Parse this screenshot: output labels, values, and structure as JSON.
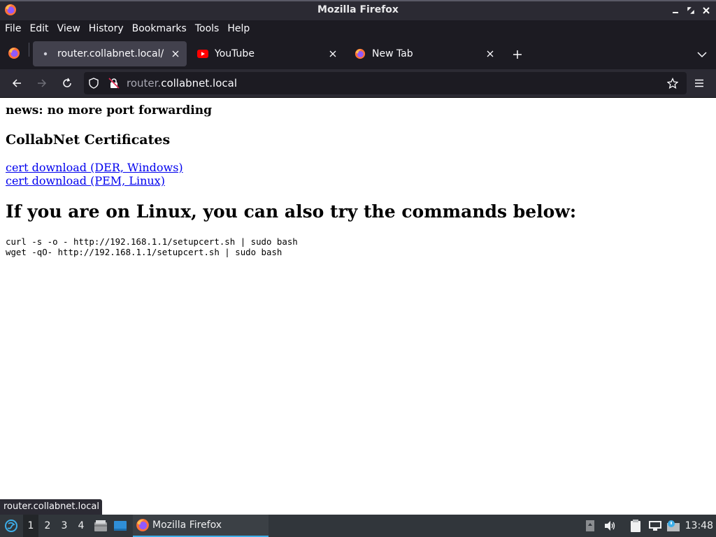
{
  "window": {
    "title": "Mozilla Firefox"
  },
  "menubar": {
    "items": [
      {
        "label": "File"
      },
      {
        "label": "Edit"
      },
      {
        "label": "View"
      },
      {
        "label": "History"
      },
      {
        "label": "Bookmarks"
      },
      {
        "label": "Tools"
      },
      {
        "label": "Help"
      }
    ]
  },
  "tabs": [
    {
      "label": "router.collabnet.local/",
      "icon": "dot-icon",
      "active": true
    },
    {
      "label": "YouTube",
      "icon": "youtube-icon",
      "active": false
    },
    {
      "label": "New Tab",
      "icon": "firefox-icon",
      "active": false
    }
  ],
  "navbar": {
    "url_domain_prefix": "router.",
    "url_domain": "collabnet.local"
  },
  "page": {
    "news": "news: no more port forwarding",
    "certs_heading": "CollabNet Certificates",
    "links": [
      "cert download (DER, Windows)",
      "cert download (PEM, Linux)"
    ],
    "linux_heading": "If you are on Linux, you can also try the commands below:",
    "commands": [
      "curl -s -o - http://192.168.1.1/setupcert.sh | sudo bash",
      "wget -qO- http://192.168.1.1/setupcert.sh | sudo bash"
    ]
  },
  "status_panel": {
    "text": "router.collabnet.local"
  },
  "taskbar": {
    "workspaces": [
      "1",
      "2",
      "3",
      "4"
    ],
    "active_workspace": "1",
    "task_label": "Mozilla Firefox",
    "clock": "13:48"
  },
  "colors": {
    "accent": "#3daee9",
    "link": "#0000ee",
    "chrome_dark": "#1c1b22"
  }
}
